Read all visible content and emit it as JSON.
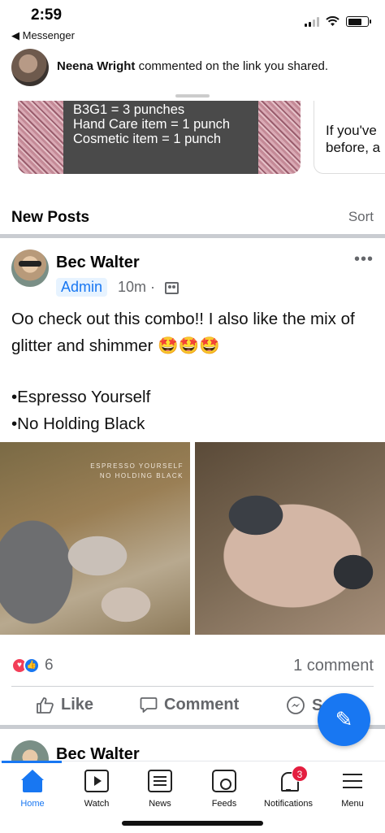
{
  "status_bar": {
    "time": "2:59",
    "back_label": "◀ Messenger"
  },
  "notification": {
    "actor": "Neena Wright",
    "message": " commented on the link you shared."
  },
  "previous_card": {
    "lines": [
      "B3G1 = 3 punches",
      "Hand Care item = 1 punch",
      "Cosmetic item = 1 punch"
    ],
    "side_text_1": "If you've",
    "side_text_2": "before, a"
  },
  "section": {
    "title": "New Posts",
    "sort_label": "Sort"
  },
  "post": {
    "author": "Bec Walter",
    "role_badge": "Admin",
    "time": "10m ·",
    "more_label": "•••",
    "text_line_1": "Oo check out this combo!! I also like the mix of glitter and shimmer 🤩🤩🤩",
    "text_line_2": "•Espresso Yourself",
    "text_line_3": "•No Holding Black",
    "photo_watermark": "ESPRESSO YOURSELF\nNO HOLDING BLACK",
    "reaction_count": "6",
    "comment_count": "1 comment",
    "actions": {
      "like": "Like",
      "comment": "Comment",
      "share": "S"
    }
  },
  "next_post": {
    "author": "Bec Walter"
  },
  "bottom_nav": {
    "tabs": [
      {
        "label": "Home"
      },
      {
        "label": "Watch"
      },
      {
        "label": "News"
      },
      {
        "label": "Feeds"
      },
      {
        "label": "Notifications"
      },
      {
        "label": "Menu"
      }
    ],
    "notifications_badge": "3",
    "active_color": "#1877f2"
  }
}
